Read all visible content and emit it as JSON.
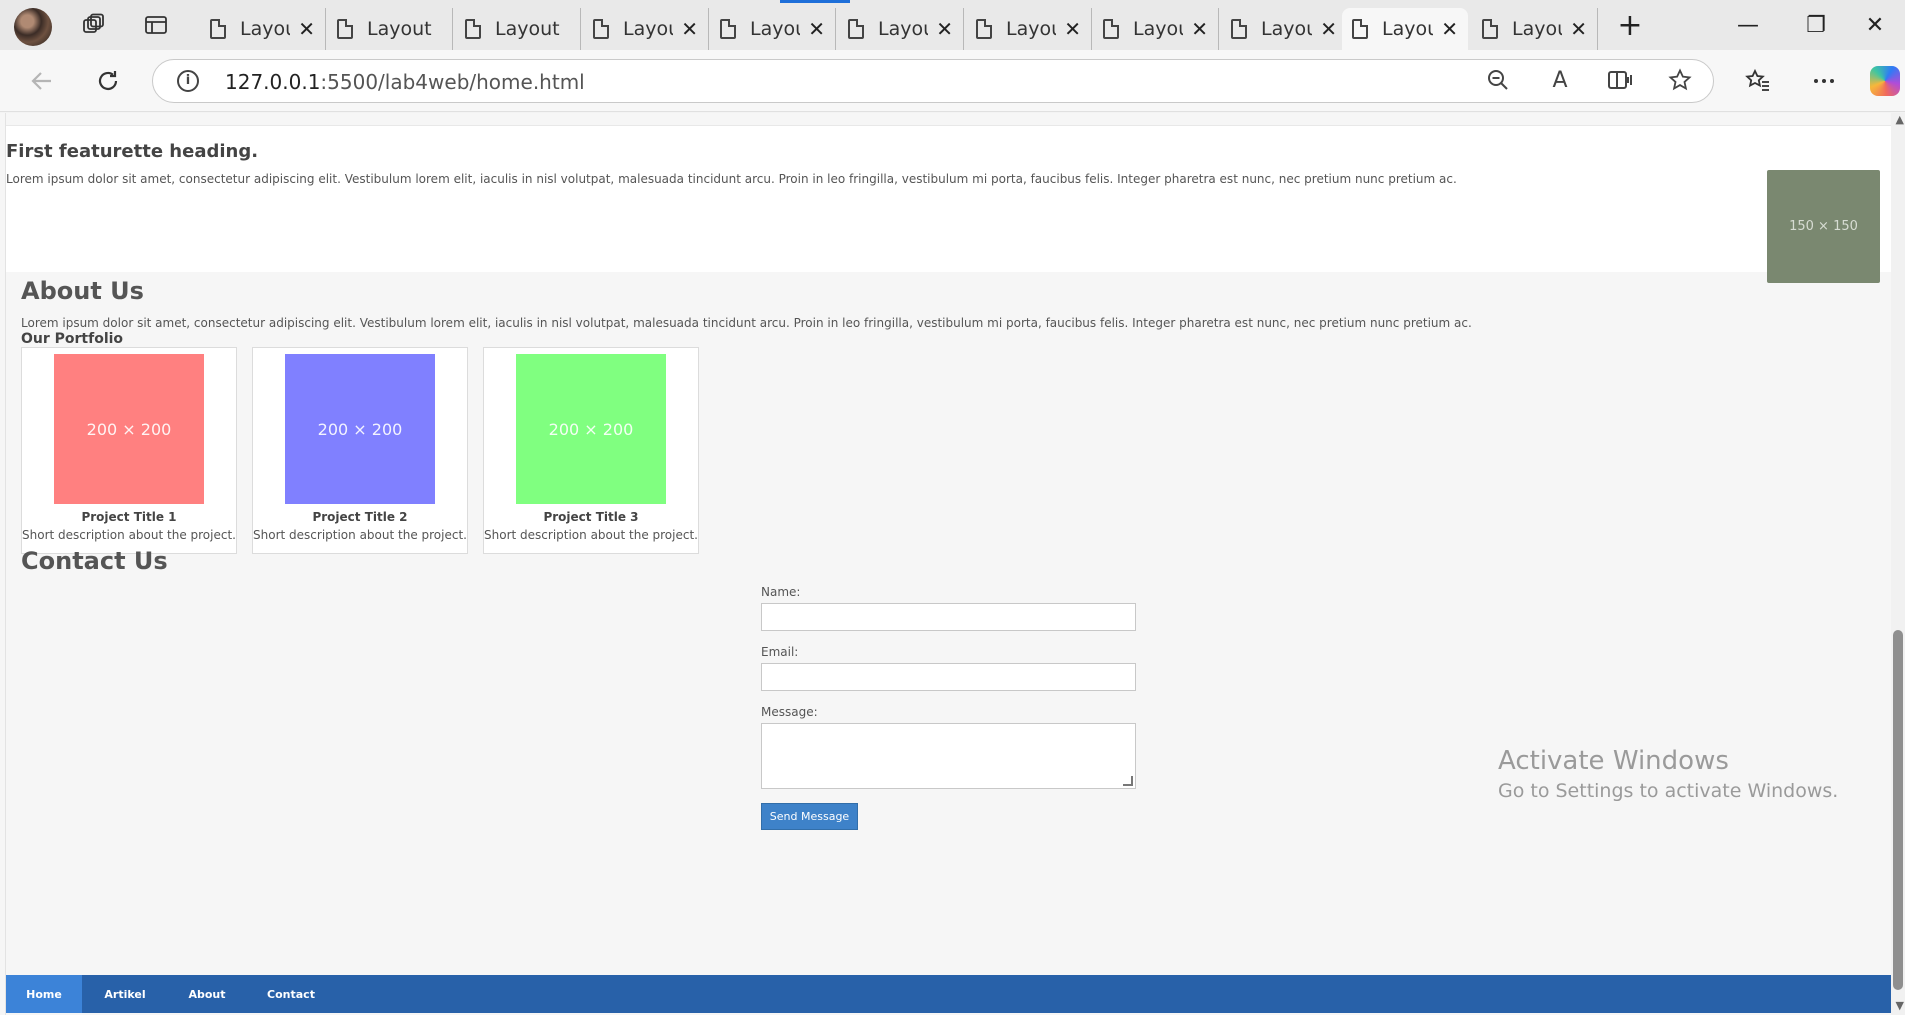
{
  "browser": {
    "tabs": [
      {
        "title": "Layout"
      },
      {
        "title": "Layout"
      },
      {
        "title": "Layout"
      },
      {
        "title": "Layout"
      },
      {
        "title": "Layout"
      },
      {
        "title": "Layout"
      },
      {
        "title": "Layout"
      },
      {
        "title": "Layout"
      },
      {
        "title": "Layout"
      },
      {
        "title": "Layout"
      },
      {
        "title": "Layout"
      }
    ],
    "tab_close_glyph": "✕",
    "new_tab_glyph": "+",
    "url_host": "127.0.0.1",
    "url_rest": ":5500/lab4web/home.html",
    "read_aloud_glyph": "A",
    "minimize_glyph": "—",
    "restore_glyph": "❐",
    "close_glyph": "✕"
  },
  "feature": {
    "heading": "First featurette heading.",
    "text": "Lorem ipsum dolor sit amet, consectetur adipiscing elit. Vestibulum lorem elit, iaculis in nisl volutpat, malesuada tincidunt arcu. Proin in leo fringilla, vestibulum mi porta, faucibus felis. Integer pharetra est nunc, nec pretium nunc pretium ac.",
    "image_label": "150 × 150",
    "image_color": "#7a8870"
  },
  "about": {
    "heading": "About Us",
    "text": "Lorem ipsum dolor sit amet, consectetur adipiscing elit. Vestibulum lorem elit, iaculis in nisl volutpat, malesuada tincidunt arcu. Proin in leo fringilla, vestibulum mi porta, faucibus felis. Integer pharetra est nunc, nec pretium nunc pretium ac.",
    "portfolio_heading": "Our Portfolio",
    "projects": [
      {
        "image_label": "200 × 200",
        "color": "#ff8080",
        "title": "Project Title 1",
        "description": "Short description about the project."
      },
      {
        "image_label": "200 × 200",
        "color": "#8080ff",
        "title": "Project Title 2",
        "description": "Short description about the project."
      },
      {
        "image_label": "200 × 200",
        "color": "#80ff80",
        "title": "Project Title 3",
        "description": "Short description about the project."
      }
    ]
  },
  "contact": {
    "heading": "Contact Us",
    "name_label": "Name:",
    "email_label": "Email:",
    "message_label": "Message:",
    "name_value": "",
    "email_value": "",
    "message_value": "",
    "submit_label": "Send Message"
  },
  "watermark": {
    "line1": "Activate Windows",
    "line2": "Go to Settings to activate Windows."
  },
  "nav": {
    "items": [
      {
        "label": "Home",
        "active": true
      },
      {
        "label": "Artikel"
      },
      {
        "label": "About"
      },
      {
        "label": "Contact"
      }
    ],
    "bar_color": "#2861a9",
    "active_color": "#3c83d8"
  }
}
